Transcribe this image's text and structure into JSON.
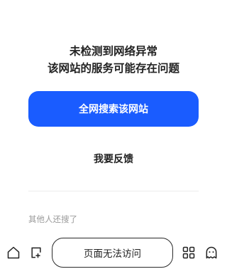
{
  "message": {
    "line1": "未检测到网络异常",
    "line2": "该网站的服务可能存在问题"
  },
  "primary_action": {
    "label": "全网搜索该网站"
  },
  "feedback": {
    "label": "我要反馈"
  },
  "others": {
    "label": "其他人还搜了"
  },
  "bottom_bar": {
    "status_label": "页面无法访问",
    "icons": [
      "home-icon",
      "tab-switch-icon",
      "apps-grid-icon",
      "ghost-icon"
    ]
  },
  "colors": {
    "accent": "#1a5cff",
    "text": "#222222",
    "muted": "#9a9a9a",
    "divider": "#ececec"
  }
}
